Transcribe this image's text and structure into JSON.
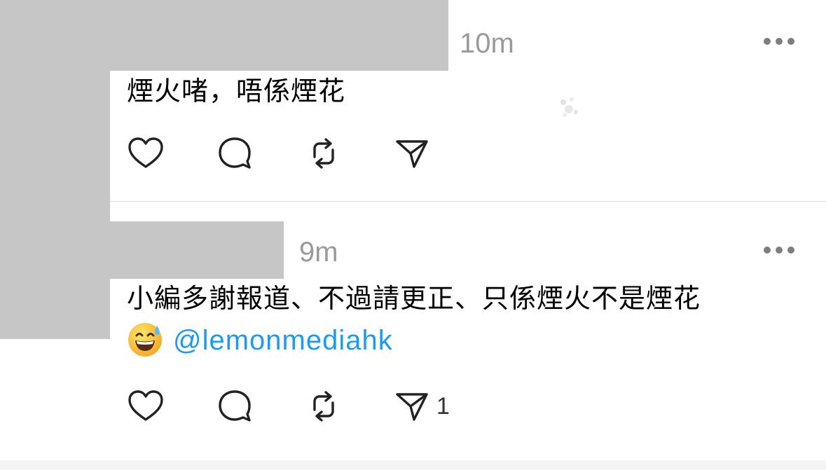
{
  "posts": [
    {
      "time": "10m",
      "text": "煙火啫，唔係煙花",
      "actions": [
        "heart-icon",
        "comment-icon",
        "repost-icon",
        "share-icon"
      ]
    },
    {
      "time": "9m",
      "text_line1": "小編多謝報道、不過請更正、只係煙火不是煙花",
      "emoji": "grinning-face-with-sweat",
      "mention": "@lemonmediahk",
      "share_count": "1",
      "actions": [
        "heart-icon",
        "comment-icon",
        "repost-icon",
        "share-icon"
      ]
    }
  ],
  "colors": {
    "redaction": "#c6c6c6",
    "mention": "#1d9bf0",
    "time": "#9a9a9a"
  }
}
